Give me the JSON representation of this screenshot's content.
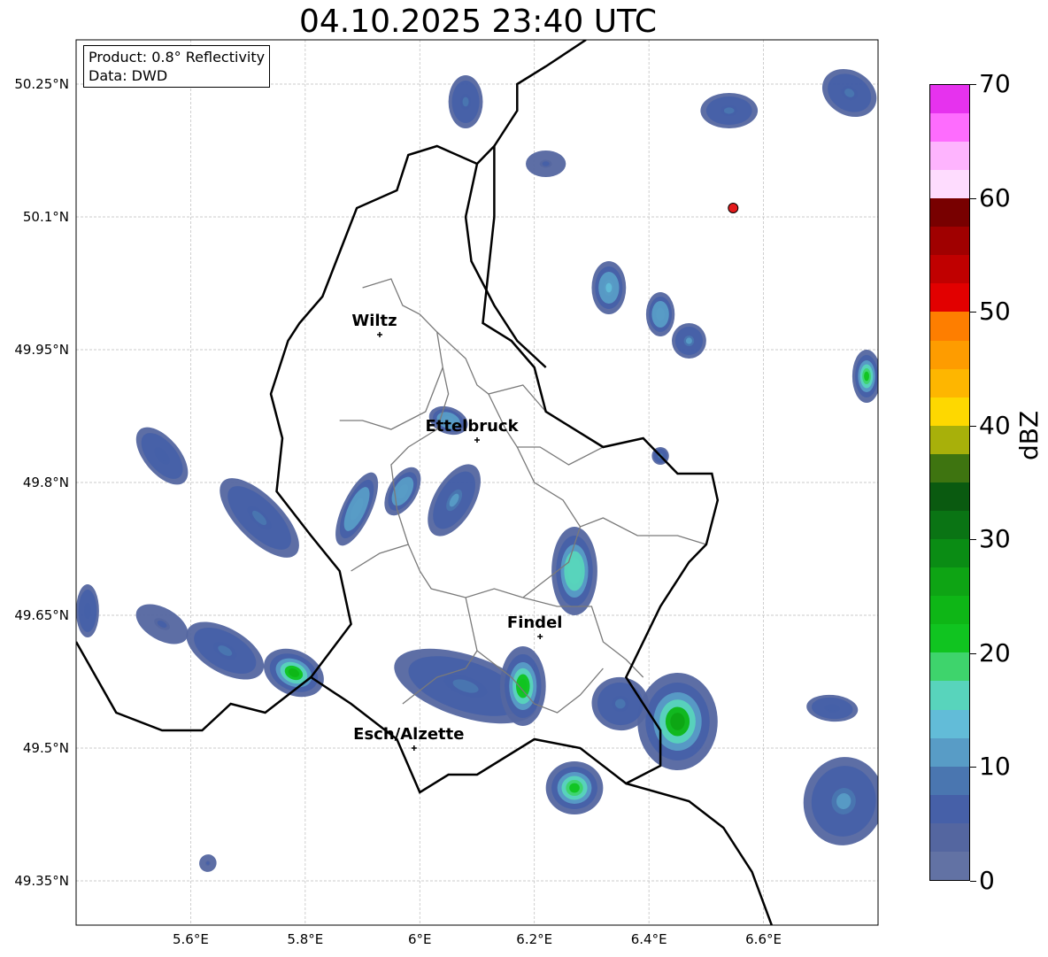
{
  "title": "04.10.2025 23:40 UTC",
  "info_box": {
    "product": "Product: 0.8° Reflectivity",
    "source": "Data: DWD"
  },
  "map": {
    "lon_range": [
      5.4,
      6.8
    ],
    "lat_range": [
      49.3,
      50.3
    ],
    "lat_ticks": [
      {
        "value": 50.25,
        "label": "50.25°N"
      },
      {
        "value": 50.1,
        "label": "50.1°N"
      },
      {
        "value": 49.95,
        "label": "49.95°N"
      },
      {
        "value": 49.8,
        "label": "49.8°N"
      },
      {
        "value": 49.65,
        "label": "49.65°N"
      },
      {
        "value": 49.5,
        "label": "49.5°N"
      },
      {
        "value": 49.35,
        "label": "49.35°N"
      }
    ],
    "lon_ticks": [
      {
        "value": 5.6,
        "label": "5.6°E"
      },
      {
        "value": 5.8,
        "label": "5.8°E"
      },
      {
        "value": 6.0,
        "label": "6°E"
      },
      {
        "value": 6.2,
        "label": "6.2°E"
      },
      {
        "value": 6.4,
        "label": "6.4°E"
      },
      {
        "value": 6.6,
        "label": "6.6°E"
      }
    ],
    "gridlines": true,
    "cities": [
      {
        "name": "Wiltz",
        "lon": 5.93,
        "lat": 49.967
      },
      {
        "name": "Ettelbruck",
        "lon": 6.1,
        "lat": 49.848
      },
      {
        "name": "Findel",
        "lon": 6.21,
        "lat": 49.626
      },
      {
        "name": "Esch/Alzette",
        "lon": 5.99,
        "lat": 49.5
      }
    ],
    "radar_site": {
      "lon": 6.547,
      "lat": 50.11,
      "color": "#e41a1c"
    },
    "luxembourg_border": [
      [
        6.13,
        50.18
      ],
      [
        6.1,
        50.16
      ],
      [
        6.03,
        50.18
      ],
      [
        5.98,
        50.17
      ],
      [
        5.96,
        50.13
      ],
      [
        5.89,
        50.11
      ],
      [
        5.86,
        50.06
      ],
      [
        5.83,
        50.01
      ],
      [
        5.79,
        49.98
      ],
      [
        5.77,
        49.96
      ],
      [
        5.74,
        49.9
      ],
      [
        5.76,
        49.85
      ],
      [
        5.75,
        49.79
      ],
      [
        5.81,
        49.74
      ],
      [
        5.86,
        49.7
      ],
      [
        5.88,
        49.64
      ],
      [
        5.81,
        49.58
      ],
      [
        5.88,
        49.55
      ],
      [
        5.96,
        49.51
      ],
      [
        6.0,
        49.45
      ],
      [
        6.05,
        49.47
      ],
      [
        6.1,
        49.47
      ],
      [
        6.2,
        49.51
      ],
      [
        6.28,
        49.5
      ],
      [
        6.36,
        49.46
      ],
      [
        6.42,
        49.48
      ],
      [
        6.42,
        49.52
      ],
      [
        6.36,
        49.58
      ],
      [
        6.42,
        49.66
      ],
      [
        6.47,
        49.71
      ],
      [
        6.5,
        49.73
      ],
      [
        6.52,
        49.78
      ],
      [
        6.51,
        49.81
      ],
      [
        6.45,
        49.81
      ],
      [
        6.39,
        49.85
      ],
      [
        6.32,
        49.84
      ],
      [
        6.22,
        49.88
      ],
      [
        6.2,
        49.93
      ],
      [
        6.16,
        49.96
      ],
      [
        6.11,
        49.98
      ],
      [
        6.12,
        50.04
      ],
      [
        6.13,
        50.1
      ],
      [
        6.13,
        50.18
      ]
    ],
    "other_borders": [
      [
        [
          5.4,
          49.62
        ],
        [
          5.47,
          49.54
        ],
        [
          5.55,
          49.52
        ],
        [
          5.62,
          49.52
        ],
        [
          5.67,
          49.55
        ],
        [
          5.73,
          49.54
        ],
        [
          5.81,
          49.58
        ]
      ],
      [
        [
          6.36,
          49.46
        ],
        [
          6.47,
          49.44
        ],
        [
          6.53,
          49.41
        ],
        [
          6.58,
          49.36
        ],
        [
          6.62,
          49.29
        ]
      ],
      [
        [
          6.13,
          50.18
        ],
        [
          6.17,
          50.22
        ],
        [
          6.17,
          50.25
        ],
        [
          6.22,
          50.27
        ],
        [
          6.29,
          50.3
        ]
      ],
      [
        [
          6.1,
          50.16
        ],
        [
          6.08,
          50.1
        ],
        [
          6.09,
          50.05
        ],
        [
          6.13,
          50.0
        ],
        [
          6.17,
          49.96
        ],
        [
          6.22,
          49.93
        ]
      ]
    ],
    "canton_borders": [
      [
        [
          5.9,
          50.02
        ],
        [
          5.95,
          50.03
        ],
        [
          5.97,
          50.0
        ],
        [
          6.0,
          49.99
        ],
        [
          6.03,
          49.97
        ],
        [
          6.04,
          49.93
        ],
        [
          6.01,
          49.88
        ],
        [
          5.95,
          49.86
        ],
        [
          5.9,
          49.87
        ],
        [
          5.86,
          49.87
        ]
      ],
      [
        [
          6.03,
          49.97
        ],
        [
          6.08,
          49.94
        ],
        [
          6.1,
          49.91
        ],
        [
          6.12,
          49.9
        ],
        [
          6.18,
          49.91
        ],
        [
          6.22,
          49.88
        ]
      ],
      [
        [
          6.04,
          49.93
        ],
        [
          6.05,
          49.9
        ],
        [
          6.03,
          49.86
        ],
        [
          5.98,
          49.84
        ],
        [
          5.95,
          49.82
        ],
        [
          5.96,
          49.77
        ],
        [
          5.98,
          49.73
        ],
        [
          6.0,
          49.7
        ],
        [
          6.02,
          49.68
        ],
        [
          6.08,
          49.67
        ],
        [
          6.13,
          49.68
        ],
        [
          6.18,
          49.67
        ]
      ],
      [
        [
          6.12,
          49.9
        ],
        [
          6.15,
          49.86
        ],
        [
          6.17,
          49.84
        ],
        [
          6.21,
          49.84
        ],
        [
          6.26,
          49.82
        ],
        [
          6.32,
          49.84
        ]
      ],
      [
        [
          6.17,
          49.84
        ],
        [
          6.2,
          49.8
        ],
        [
          6.25,
          49.78
        ],
        [
          6.28,
          49.75
        ],
        [
          6.32,
          49.76
        ],
        [
          6.38,
          49.74
        ],
        [
          6.45,
          49.74
        ],
        [
          6.5,
          49.73
        ]
      ],
      [
        [
          6.18,
          49.67
        ],
        [
          6.22,
          49.69
        ],
        [
          6.26,
          49.71
        ],
        [
          6.28,
          49.75
        ]
      ],
      [
        [
          6.18,
          49.67
        ],
        [
          6.24,
          49.66
        ],
        [
          6.3,
          49.66
        ],
        [
          6.32,
          49.62
        ],
        [
          6.36,
          49.6
        ],
        [
          6.39,
          49.58
        ]
      ],
      [
        [
          6.08,
          49.67
        ],
        [
          6.1,
          49.61
        ],
        [
          6.16,
          49.58
        ],
        [
          6.2,
          49.55
        ],
        [
          6.24,
          49.54
        ],
        [
          6.28,
          49.56
        ],
        [
          6.32,
          49.59
        ]
      ],
      [
        [
          5.98,
          49.73
        ],
        [
          5.93,
          49.72
        ],
        [
          5.88,
          49.7
        ]
      ],
      [
        [
          5.97,
          49.55
        ],
        [
          6.03,
          49.58
        ],
        [
          6.08,
          49.59
        ],
        [
          6.1,
          49.61
        ]
      ]
    ]
  },
  "colorbar": {
    "label": "dBZ",
    "min": 0,
    "max": 70,
    "step": 2.5,
    "tick_values": [
      0,
      10,
      20,
      30,
      40,
      50,
      60,
      70
    ],
    "tick_labels": [
      "0",
      "10",
      "20",
      "30",
      "40",
      "50",
      "60",
      "70"
    ],
    "colors": [
      "#6272a4",
      "#5466a0",
      "#4660a8",
      "#4a76b0",
      "#589cc6",
      "#62bcd8",
      "#58d4bc",
      "#3ed46c",
      "#10c420",
      "#0eb616",
      "#0ea414",
      "#0a8c14",
      "#0a7414",
      "#0a5a10",
      "#3e7410",
      "#a8b00a",
      "#fed800",
      "#feb600",
      "#fe9c00",
      "#fe7e00",
      "#e20000",
      "#c00000",
      "#a00000",
      "#780000",
      "#fedcfe",
      "#feb4fe",
      "#fe6cfe",
      "#e632ee"
    ]
  },
  "radar_cells": [
    {
      "lon": 5.78,
      "lat": 49.585,
      "rx": 0.055,
      "ry": 0.025,
      "rot": 25,
      "dbz": 24
    },
    {
      "lon": 5.66,
      "lat": 49.61,
      "rx": 0.075,
      "ry": 0.025,
      "rot": 30,
      "dbz": 9
    },
    {
      "lon": 5.55,
      "lat": 49.64,
      "rx": 0.05,
      "ry": 0.018,
      "rot": 30,
      "dbz": 6
    },
    {
      "lon": 5.42,
      "lat": 49.655,
      "rx": 0.02,
      "ry": 0.03,
      "rot": 0,
      "dbz": 7
    },
    {
      "lon": 6.08,
      "lat": 49.57,
      "rx": 0.13,
      "ry": 0.035,
      "rot": 18,
      "dbz": 8
    },
    {
      "lon": 6.18,
      "lat": 49.57,
      "rx": 0.04,
      "ry": 0.045,
      "rot": 0,
      "dbz": 22
    },
    {
      "lon": 6.27,
      "lat": 49.455,
      "rx": 0.05,
      "ry": 0.03,
      "rot": 0,
      "dbz": 21
    },
    {
      "lon": 6.45,
      "lat": 49.53,
      "rx": 0.07,
      "ry": 0.055,
      "rot": 0,
      "dbz": 25
    },
    {
      "lon": 6.35,
      "lat": 49.55,
      "rx": 0.05,
      "ry": 0.03,
      "rot": 10,
      "dbz": 8
    },
    {
      "lon": 6.74,
      "lat": 49.44,
      "rx": 0.07,
      "ry": 0.05,
      "rot": 10,
      "dbz": 10
    },
    {
      "lon": 6.72,
      "lat": 49.545,
      "rx": 0.045,
      "ry": 0.015,
      "rot": 5,
      "dbz": 7
    },
    {
      "lon": 6.27,
      "lat": 49.7,
      "rx": 0.04,
      "ry": 0.05,
      "rot": 0,
      "dbz": 17
    },
    {
      "lon": 6.06,
      "lat": 49.78,
      "rx": 0.035,
      "ry": 0.045,
      "rot": 30,
      "dbz": 10
    },
    {
      "lon": 5.97,
      "lat": 49.79,
      "rx": 0.025,
      "ry": 0.03,
      "rot": 30,
      "dbz": 12
    },
    {
      "lon": 5.89,
      "lat": 49.77,
      "rx": 0.025,
      "ry": 0.045,
      "rot": 25,
      "dbz": 12
    },
    {
      "lon": 6.05,
      "lat": 49.87,
      "rx": 0.035,
      "ry": 0.015,
      "rot": 20,
      "dbz": 12
    },
    {
      "lon": 5.72,
      "lat": 49.76,
      "rx": 0.09,
      "ry": 0.025,
      "rot": 45,
      "dbz": 8
    },
    {
      "lon": 5.55,
      "lat": 49.83,
      "rx": 0.06,
      "ry": 0.02,
      "rot": 50,
      "dbz": 7
    },
    {
      "lon": 6.47,
      "lat": 49.96,
      "rx": 0.03,
      "ry": 0.02,
      "rot": 0,
      "dbz": 11
    },
    {
      "lon": 6.33,
      "lat": 50.02,
      "rx": 0.03,
      "ry": 0.03,
      "rot": 0,
      "dbz": 14
    },
    {
      "lon": 6.42,
      "lat": 49.99,
      "rx": 0.025,
      "ry": 0.025,
      "rot": 0,
      "dbz": 12
    },
    {
      "lon": 6.78,
      "lat": 49.92,
      "rx": 0.025,
      "ry": 0.03,
      "rot": 0,
      "dbz": 20
    },
    {
      "lon": 6.54,
      "lat": 50.22,
      "rx": 0.05,
      "ry": 0.02,
      "rot": 0,
      "dbz": 9
    },
    {
      "lon": 6.75,
      "lat": 50.24,
      "rx": 0.05,
      "ry": 0.025,
      "rot": 30,
      "dbz": 8
    },
    {
      "lon": 6.22,
      "lat": 50.16,
      "rx": 0.035,
      "ry": 0.015,
      "rot": 0,
      "dbz": 6
    },
    {
      "lon": 6.08,
      "lat": 50.23,
      "rx": 0.03,
      "ry": 0.03,
      "rot": 0,
      "dbz": 8
    },
    {
      "lon": 6.42,
      "lat": 49.83,
      "rx": 0.015,
      "ry": 0.01,
      "rot": 0,
      "dbz": 11
    },
    {
      "lon": 5.63,
      "lat": 49.37,
      "rx": 0.015,
      "ry": 0.01,
      "rot": 30,
      "dbz": 5
    }
  ]
}
